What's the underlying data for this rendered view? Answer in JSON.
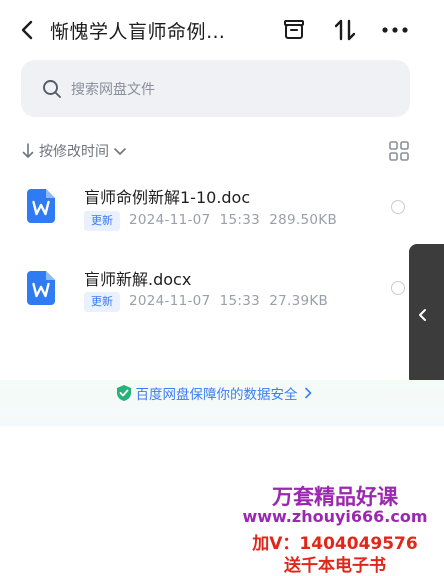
{
  "header": {
    "title": "惭愧学人盲师命例…"
  },
  "search": {
    "placeholder": "搜索网盘文件"
  },
  "sort": {
    "label": "按修改时间"
  },
  "files": [
    {
      "name": "盲师命例新解1-10.doc",
      "badge": "更新",
      "date": "2024-11-07",
      "time": "15:33",
      "size": "289.50KB"
    },
    {
      "name": "盲师新解.docx",
      "badge": "更新",
      "date": "2024-11-07",
      "time": "15:33",
      "size": "27.39KB"
    }
  ],
  "footer": {
    "security_text": "百度网盘保障你的数据安全"
  },
  "watermark": {
    "line1": "万套精品好课",
    "line2": "www.zhouyi666.com",
    "line3": "加V：1404049576",
    "line4": "送千本电子书"
  },
  "colors": {
    "accent": "#3d7cf1",
    "doc_icon": "#2f7bf3",
    "watermark_purple": "#9c27b0",
    "watermark_red": "#e0271a"
  }
}
